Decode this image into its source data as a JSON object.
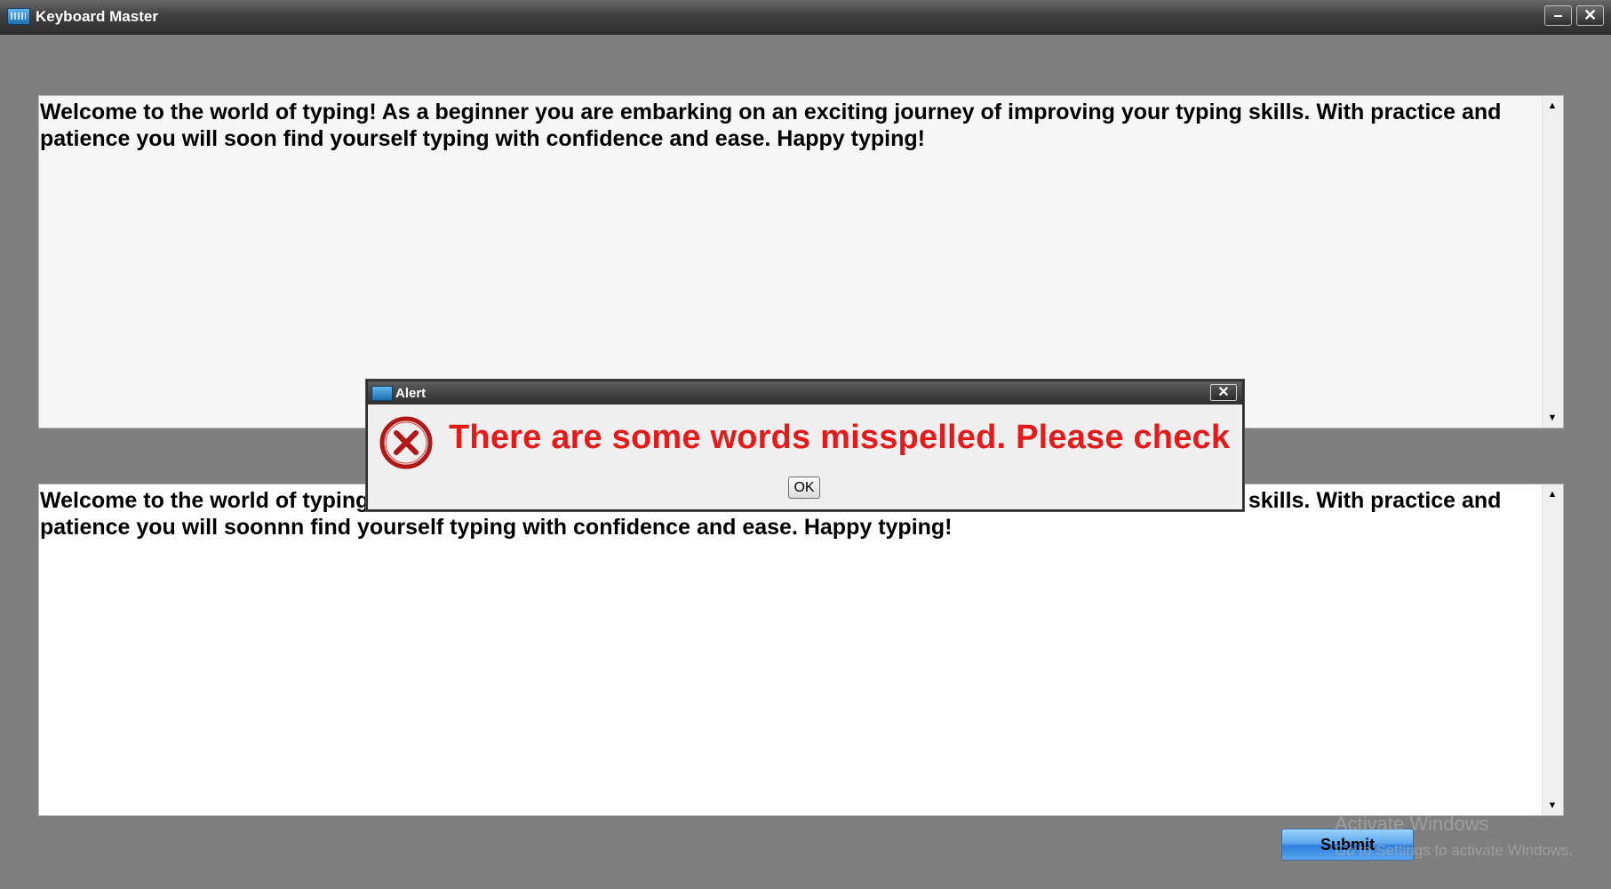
{
  "window": {
    "title": "Keyboard Master",
    "minimize_glyph": "–",
    "close_glyph": "✕"
  },
  "reference_text": {
    "content": "Welcome to the world of typing! As a beginner you are embarking on an exciting journey of improving your typing skills. With practice and patience you will soon find yourself typing with confidence and ease. Happy typing!"
  },
  "typed_text": {
    "content": "Welcome to the world of typing! As a beginner you are embarking on an exciting journey of improving your typing skills. With practice and patience you will soonnn find yourself typing with confidence and ease. Happy typing!"
  },
  "scroll": {
    "up_glyph": "▲",
    "down_glyph": "▼"
  },
  "submit": {
    "label": "Submit"
  },
  "watermark": {
    "line1": "Activate Windows",
    "line2": "Go to Settings to activate Windows."
  },
  "dialog": {
    "title": "Alert",
    "close_glyph": "✕",
    "message": "There are some words misspelled. Please check",
    "ok_label": "OK",
    "error_icon": "error-circle-x-icon",
    "message_color": "#e31b1b"
  }
}
